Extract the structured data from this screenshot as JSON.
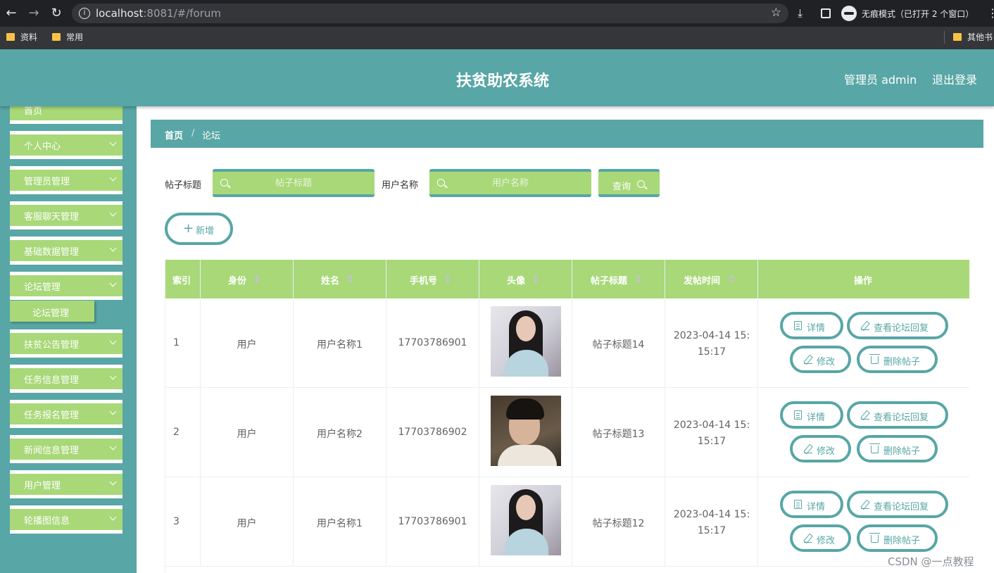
{
  "browser": {
    "url_host": "localhost",
    "url_rest": ":8081/#/forum",
    "incognito_text": "无痕模式（已打开 2 个窗口）",
    "bookmarks": [
      "资料",
      "常用"
    ],
    "other_bookmarks": "其他书"
  },
  "app": {
    "title": "扶贫助农系统",
    "admin_label": "管理员 admin",
    "logout": "退出登录"
  },
  "sidebar": {
    "items": [
      {
        "label": "首页",
        "chevron": false
      },
      {
        "label": "个人中心",
        "chevron": true
      },
      {
        "label": "管理员管理",
        "chevron": true
      },
      {
        "label": "客服聊天管理",
        "chevron": true
      },
      {
        "label": "基础数据管理",
        "chevron": true
      },
      {
        "label": "论坛管理",
        "chevron": true
      },
      {
        "label": "扶贫公告管理",
        "chevron": true
      },
      {
        "label": "任务信息管理",
        "chevron": true
      },
      {
        "label": "任务报名管理",
        "chevron": true
      },
      {
        "label": "新闻信息管理",
        "chevron": true
      },
      {
        "label": "用户管理",
        "chevron": true
      },
      {
        "label": "轮播图信息",
        "chevron": true
      }
    ],
    "sub_item": "论坛管理"
  },
  "breadcrumb": {
    "home": "首页",
    "separator": "/",
    "current": "论坛"
  },
  "search": {
    "title_label": "帖子标题",
    "title_placeholder": "帖子标题",
    "user_label": "用户名称",
    "user_placeholder": "用户名称",
    "query_label": "查询"
  },
  "add_button": "新增",
  "table": {
    "headers": [
      "索引",
      "身份",
      "姓名",
      "手机号",
      "头像",
      "帖子标题",
      "发帖时间",
      "操作"
    ],
    "rows": [
      {
        "index": "1",
        "role": "用户",
        "name": "用户名称1",
        "phone": "17703786901",
        "avatar": "female-portrait",
        "title": "帖子标题14",
        "time": "2023-04-14 15:15:17"
      },
      {
        "index": "2",
        "role": "用户",
        "name": "用户名称2",
        "phone": "17703786902",
        "avatar": "male-portrait",
        "title": "帖子标题13",
        "time": "2023-04-14 15:15:17"
      },
      {
        "index": "3",
        "role": "用户",
        "name": "用户名称1",
        "phone": "17703786901",
        "avatar": "female-portrait",
        "title": "帖子标题12",
        "time": "2023-04-14 15:15:17"
      }
    ],
    "actions": {
      "detail": "详情",
      "view_replies": "查看论坛回复",
      "edit": "修改",
      "delete": "删除帖子"
    }
  },
  "watermark": "CSDN @一点教程",
  "colors": {
    "primary": "#58a6a6",
    "accent": "#a8d878",
    "chrome": "#202124"
  }
}
